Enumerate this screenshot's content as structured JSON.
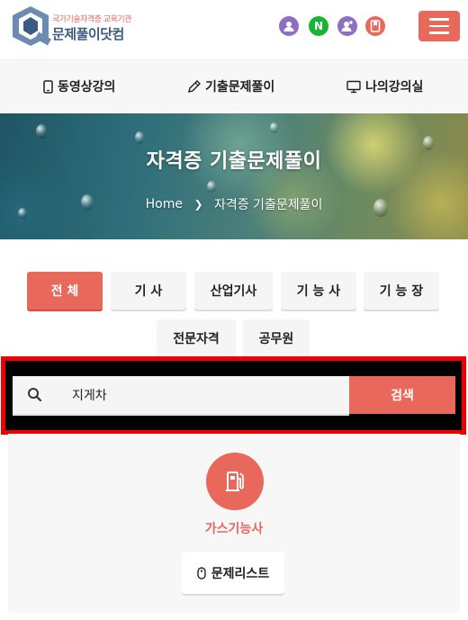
{
  "header": {
    "logo_sub": "국가기술자격증 교육기관",
    "logo_main": "문제풀이닷컴",
    "icons": [
      {
        "name": "user-icon",
        "color": "#8e6fc4"
      },
      {
        "name": "naver-icon",
        "glyph": "N",
        "color": "#19b433"
      },
      {
        "name": "add-user-icon",
        "color": "#8e6fc4"
      },
      {
        "name": "bookmark-icon",
        "color": "#e8685c"
      }
    ],
    "menu_icon": "hamburger-icon"
  },
  "nav": {
    "items": [
      {
        "label": "동영상강의",
        "icon": "mobile-icon"
      },
      {
        "label": "기출문제풀이",
        "icon": "pencil-icon"
      },
      {
        "label": "나의강의실",
        "icon": "monitor-icon"
      }
    ]
  },
  "banner": {
    "title": "자격증 기출문제풀이",
    "breadcrumb": [
      "Home",
      "자격증 기출문제풀이"
    ]
  },
  "categories": {
    "items": [
      "전 체",
      "기 사",
      "산업기사",
      "기 능 사",
      "기 능 장",
      "전문자격",
      "공무원"
    ],
    "active": "전 체"
  },
  "search": {
    "value": "지게차",
    "button": "검색"
  },
  "result": {
    "title": "가스기능사",
    "icon": "gas-pump-icon",
    "list_button": "문제리스트"
  },
  "colors": {
    "accent": "#e8685c",
    "brand": "#3d5a80",
    "highlight_border": "#e00000"
  }
}
